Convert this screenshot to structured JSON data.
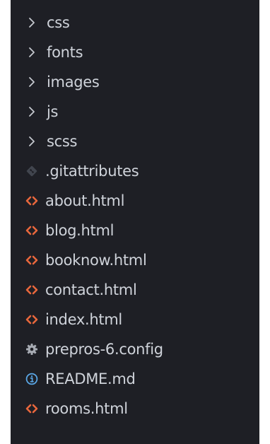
{
  "explorer": {
    "items": [
      {
        "label": "css",
        "icon": "chevron-right-icon",
        "kind": "folder"
      },
      {
        "label": "fonts",
        "icon": "chevron-right-icon",
        "kind": "folder"
      },
      {
        "label": "images",
        "icon": "chevron-right-icon",
        "kind": "folder"
      },
      {
        "label": "js",
        "icon": "chevron-right-icon",
        "kind": "folder"
      },
      {
        "label": "scss",
        "icon": "chevron-right-icon",
        "kind": "folder"
      },
      {
        "label": ".gitattributes",
        "icon": "git-icon",
        "kind": "file"
      },
      {
        "label": "about.html",
        "icon": "html-icon",
        "kind": "file"
      },
      {
        "label": "blog.html",
        "icon": "html-icon",
        "kind": "file"
      },
      {
        "label": "booknow.html",
        "icon": "html-icon",
        "kind": "file"
      },
      {
        "label": "contact.html",
        "icon": "html-icon",
        "kind": "file"
      },
      {
        "label": "index.html",
        "icon": "html-icon",
        "kind": "file"
      },
      {
        "label": "prepros-6.config",
        "icon": "gear-icon",
        "kind": "file"
      },
      {
        "label": "README.md",
        "icon": "info-icon",
        "kind": "file"
      },
      {
        "label": "rooms.html",
        "icon": "html-icon",
        "kind": "file"
      }
    ]
  },
  "colors": {
    "background": "#1e1f25",
    "text": "#cfd3da",
    "chevron": "#c5c8ce",
    "html": "#e8673c",
    "git": "#41454e",
    "gear": "#a7abb3",
    "info": "#5aa7e6"
  }
}
